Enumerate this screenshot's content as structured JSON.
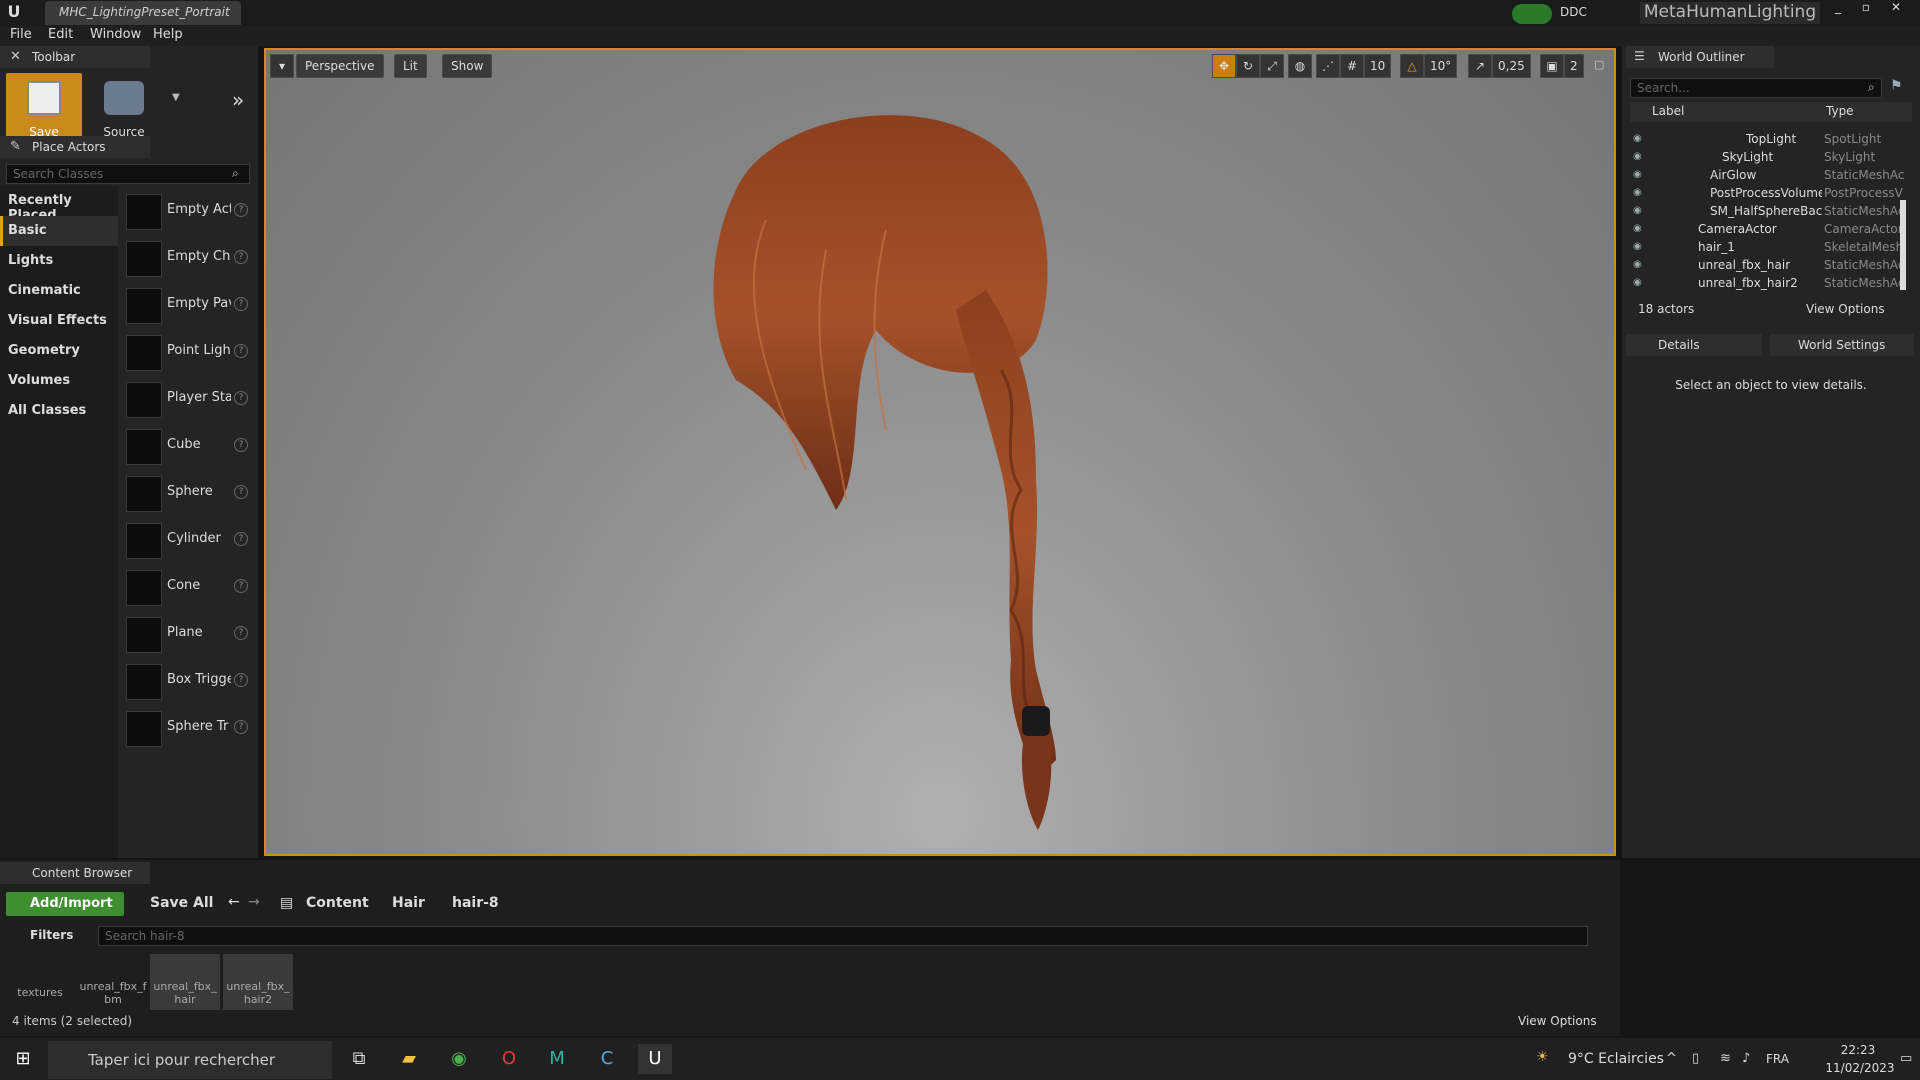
{
  "title_bar": {
    "tab_title": "MHC_LightingPreset_Portrait",
    "ddc_label": "DDC",
    "project_name": "MetaHumanLighting"
  },
  "menu": [
    "File",
    "Edit",
    "Window",
    "Help"
  ],
  "toolbar": {
    "tab_label": "Toolbar",
    "save_current": "Save Current",
    "source_control": "Source Control"
  },
  "place_actors": {
    "tab_label": "Place Actors",
    "search_placeholder": "Search Classes",
    "categories": [
      "Recently Placed",
      "Basic",
      "Lights",
      "Cinematic",
      "Visual Effects",
      "Geometry",
      "Volumes",
      "All Classes"
    ],
    "selected_category": "Basic",
    "actors": [
      "Empty Act",
      "Empty Cha",
      "Empty Pav",
      "Point Light",
      "Player Sta",
      "Cube",
      "Sphere",
      "Cylinder",
      "Cone",
      "Plane",
      "Box Trigge",
      "Sphere Tr"
    ]
  },
  "viewport": {
    "perspective": "Perspective",
    "lit": "Lit",
    "show": "Show",
    "grid_snap": "10",
    "rotation_snap": "10°",
    "scale_snap": "0,25",
    "camera_speed": "2"
  },
  "world_outliner": {
    "tab_label": "World Outliner",
    "search_placeholder": "Search...",
    "col_label": "Label",
    "col_type": "Type",
    "rows": [
      {
        "label": "TopLight",
        "type": "SpotLight"
      },
      {
        "label": "SkyLight",
        "type": "SkyLight"
      },
      {
        "label": "AirGlow",
        "type": "StaticMeshAc"
      },
      {
        "label": "PostProcessVolume",
        "type": "PostProcessV"
      },
      {
        "label": "SM_HalfSphereBackg",
        "type": "StaticMeshAc"
      },
      {
        "label": "CameraActor",
        "type": "CameraActor"
      },
      {
        "label": "hair_1",
        "type": "SkeletalMesh"
      },
      {
        "label": "unreal_fbx_hair",
        "type": "StaticMeshAc"
      },
      {
        "label": "unreal_fbx_hair2",
        "type": "StaticMeshAc"
      }
    ],
    "actor_count": "18 actors",
    "view_options": "View Options"
  },
  "details": {
    "details_tab": "Details",
    "world_settings_tab": "World Settings",
    "empty_message": "Select an object to view details."
  },
  "content_browser": {
    "tab_label": "Content Browser",
    "add_import": "Add/Import",
    "save_all": "Save All",
    "path": [
      "Content",
      "Hair",
      "hair-8"
    ],
    "filters": "Filters",
    "search_placeholder": "Search hair-8",
    "items": [
      "textures",
      "unreal_fbx_fbm",
      "unreal_fbx_hair",
      "unreal_fbx_hair2"
    ],
    "status": "4 items (2 selected)",
    "view_options": "View Options"
  },
  "taskbar": {
    "search_placeholder": "Taper ici pour rechercher",
    "weather": "9°C  Eclaircies",
    "language": "FRA",
    "time": "22:23",
    "date": "11/02/2023"
  },
  "colors": {
    "accent": "#d38b15",
    "save_button": "#c98a1b",
    "add_import": "#3d8f2f",
    "hair": "#8a3a1a"
  }
}
